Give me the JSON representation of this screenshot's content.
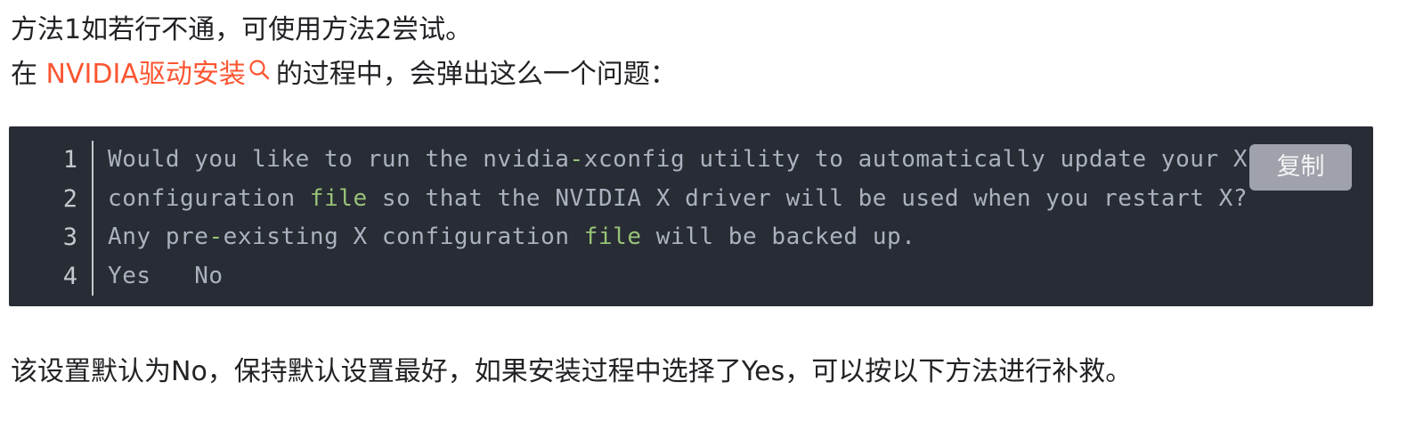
{
  "article": {
    "p1": "方法1如若行不通，可使用方法2尝试。",
    "p2_pre": "在 ",
    "p2_link": "NVIDIA驱动安装",
    "p2_post": "的过程中，会弹出这么一个问题：",
    "p3": "该设置默认为No，保持默认设置最好，如果安装过程中选择了Yes，可以按以下方法进行补救。"
  },
  "code_block": {
    "copy_label": "复制",
    "line_numbers": [
      "1",
      "2",
      "3",
      "4"
    ],
    "lines": [
      {
        "a": "Would you like to run the nvidia",
        "op": "-",
        "b": "xconfig utility to automatically update your X"
      },
      {
        "a": "configuration ",
        "kw": "file",
        "b": " so that the NVIDIA X driver will be used when you restart X?"
      },
      {
        "a": "Any pre",
        "op": "-",
        "b": "existing X configuration ",
        "kw": "file",
        "c": " will be backed up."
      },
      {
        "a": "Yes   No"
      }
    ]
  },
  "colors": {
    "link": "#fc5531",
    "code_bg": "#282c34",
    "code_text": "#abb2bf",
    "keyword": "#98c379"
  }
}
